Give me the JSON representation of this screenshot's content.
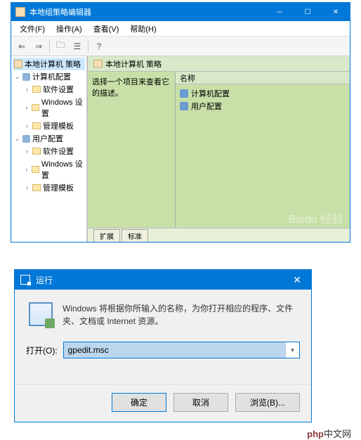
{
  "gpedit": {
    "title": "本地组策略编辑器",
    "menu": {
      "file": "文件(F)",
      "action": "操作(A)",
      "view": "查看(V)",
      "help": "帮助(H)"
    },
    "tree": {
      "root": "本地计算机 策略",
      "computer": {
        "label": "计算机配置",
        "children": [
          "软件设置",
          "Windows 设置",
          "管理模板"
        ]
      },
      "user": {
        "label": "用户配置",
        "children": [
          "软件设置",
          "Windows 设置",
          "管理模板"
        ]
      }
    },
    "content": {
      "header": "本地计算机 策略",
      "desc": "选择一个项目来查看它的描述。",
      "col_name": "名称",
      "items": [
        "计算机配置",
        "用户配置"
      ],
      "tabs": {
        "ext": "扩展",
        "std": "标准"
      }
    },
    "watermark": "Baidu 经验"
  },
  "run": {
    "title": "运行",
    "desc": "Windows 将根据你所输入的名称，为你打开相应的程序、文件夹、文档或 Internet 资源。",
    "open_label": "打开(O):",
    "value": "gpedit.msc",
    "buttons": {
      "ok": "确定",
      "cancel": "取消",
      "browse": "浏览(B)..."
    }
  },
  "footer": {
    "brand": "php",
    "suffix": "中文网"
  }
}
